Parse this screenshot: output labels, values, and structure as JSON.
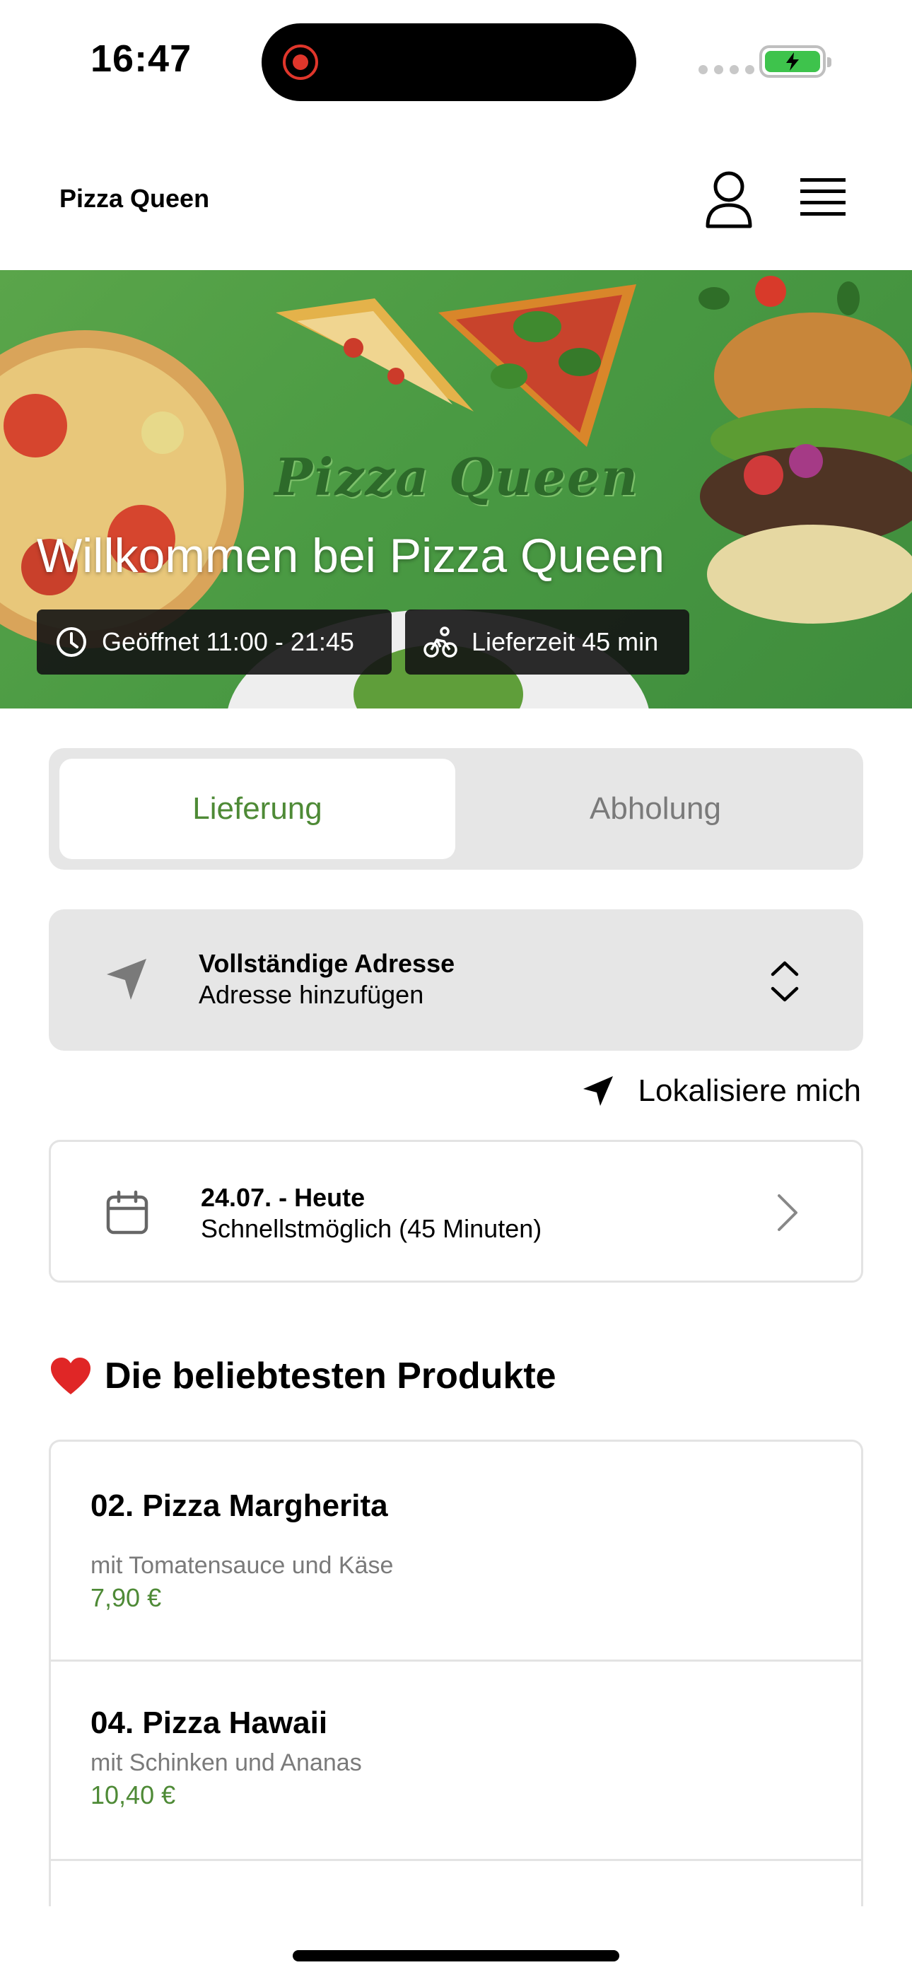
{
  "status_bar": {
    "time": "16:47"
  },
  "header": {
    "brand": "Pizza Queen"
  },
  "hero": {
    "logo_text": "Pizza Queen",
    "title": "Willkommen bei Pizza Queen",
    "hours_label": "Geöffnet 11:00 - 21:45",
    "delivery_label": "Lieferzeit 45 min"
  },
  "order_mode": {
    "tabs": [
      {
        "label": "Lieferung",
        "active": true
      },
      {
        "label": "Abholung",
        "active": false
      }
    ]
  },
  "address": {
    "title": "Vollständige Adresse",
    "subtitle": "Adresse hinzufügen"
  },
  "locate": {
    "label": "Lokalisiere mich"
  },
  "schedule": {
    "title": "24.07. - Heute",
    "subtitle": "Schnellstmöglich (45 Minuten)"
  },
  "popular": {
    "title": "Die beliebtesten Produkte",
    "items": [
      {
        "name": "02. Pizza Margherita",
        "description": "mit Tomatensauce und Käse",
        "price": "7,90 €"
      },
      {
        "name": "04. Pizza Hawaii",
        "description": "mit Schinken und Ananas",
        "price": "10,40 €"
      }
    ]
  },
  "colors": {
    "accent_green": "#4e8a36",
    "hero_green": "#4a9a43",
    "segment_bg": "#e6e6e6"
  },
  "icons": [
    "record-icon",
    "signal-icon",
    "battery-charging-icon",
    "user-icon",
    "menu-icon",
    "clock-icon",
    "bicycle-icon",
    "navigation-arrow-icon",
    "chevron-up-down-icon",
    "calendar-icon",
    "chevron-right-icon",
    "heart-icon"
  ]
}
